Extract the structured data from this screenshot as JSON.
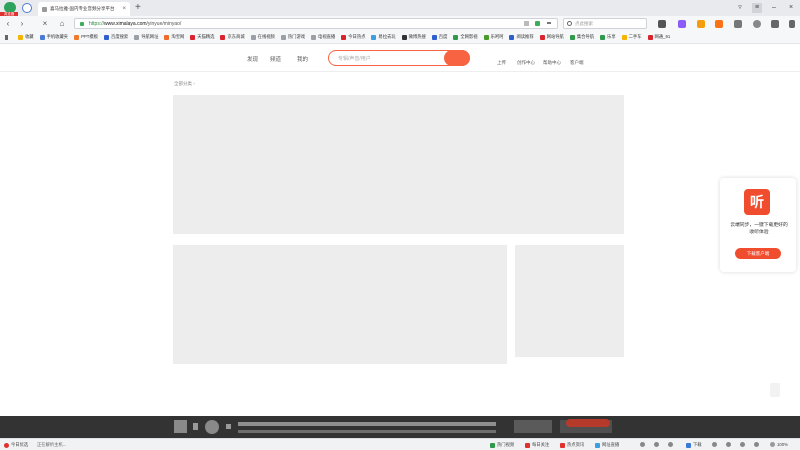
{
  "browser": {
    "logo_badge": "浏览器",
    "tab_title": "喜马拉雅-国内专业音频分享平台",
    "tab_close": "×",
    "new_tab": "+",
    "url_scheme": "https://",
    "url_host": "www.ximalaya.com",
    "url_path": "/yinyue/minyao/",
    "search_placeholder": "点此搜索",
    "bookmarks": [
      {
        "label": "收藏",
        "color": "#f5b400"
      },
      {
        "label": "手机收藏夹",
        "color": "#4a7bd4"
      },
      {
        "label": "PPT模板",
        "color": "#f07a2a"
      },
      {
        "label": "百度搜索",
        "color": "#2f5fcf"
      },
      {
        "label": "导航网址",
        "color": "#9aa0a6"
      },
      {
        "label": "淘宝网",
        "color": "#f06a2a"
      },
      {
        "label": "天猫精选",
        "color": "#d9232d"
      },
      {
        "label": "京东商城",
        "color": "#d9232d"
      },
      {
        "label": "在线视频",
        "color": "#9aa0a6"
      },
      {
        "label": "热门游戏",
        "color": "#9aa0a6"
      },
      {
        "label": "电视直播",
        "color": "#9aa0a6"
      },
      {
        "label": "今日热点",
        "color": "#d9232d"
      },
      {
        "label": "易拉去玩",
        "color": "#3aa0e0"
      },
      {
        "label": "微博热搜",
        "color": "#333333"
      },
      {
        "label": "百度",
        "color": "#2f5fcf"
      },
      {
        "label": "全网影视",
        "color": "#2f9a4a"
      },
      {
        "label": "乐呵呵",
        "color": "#4a9a2a"
      },
      {
        "label": "阅读推荐",
        "color": "#2f5fcf"
      },
      {
        "label": "网站导航",
        "color": "#d9232d"
      },
      {
        "label": "集合导航",
        "color": "#2f9a4a"
      },
      {
        "label": "乐享",
        "color": "#2f9a4a"
      },
      {
        "label": "二手车",
        "color": "#f5b400"
      },
      {
        "label": "网通_91",
        "color": "#d9232d"
      }
    ]
  },
  "site": {
    "nav": [
      "发现",
      "频道",
      "我的"
    ],
    "search_placeholder": "专辑/声音/用户",
    "header_links": [
      "上传",
      "创作中心",
      "帮助中心",
      "客户端"
    ],
    "breadcrumb": "全部分类 ›"
  },
  "promo": {
    "logo_glyph": "听",
    "text": "云端同步，一键下载更好的收听体验",
    "button": "下载客户端"
  },
  "statusbar": {
    "left": [
      "今日优选",
      "正在解析主机..."
    ],
    "right": [
      "热门视频",
      "每日关注",
      "热点资讯",
      "网址直播"
    ],
    "download": "下载",
    "zoom": "100%"
  },
  "colors": {
    "brand": "#f86442",
    "accent_red": "#f04d2e"
  }
}
